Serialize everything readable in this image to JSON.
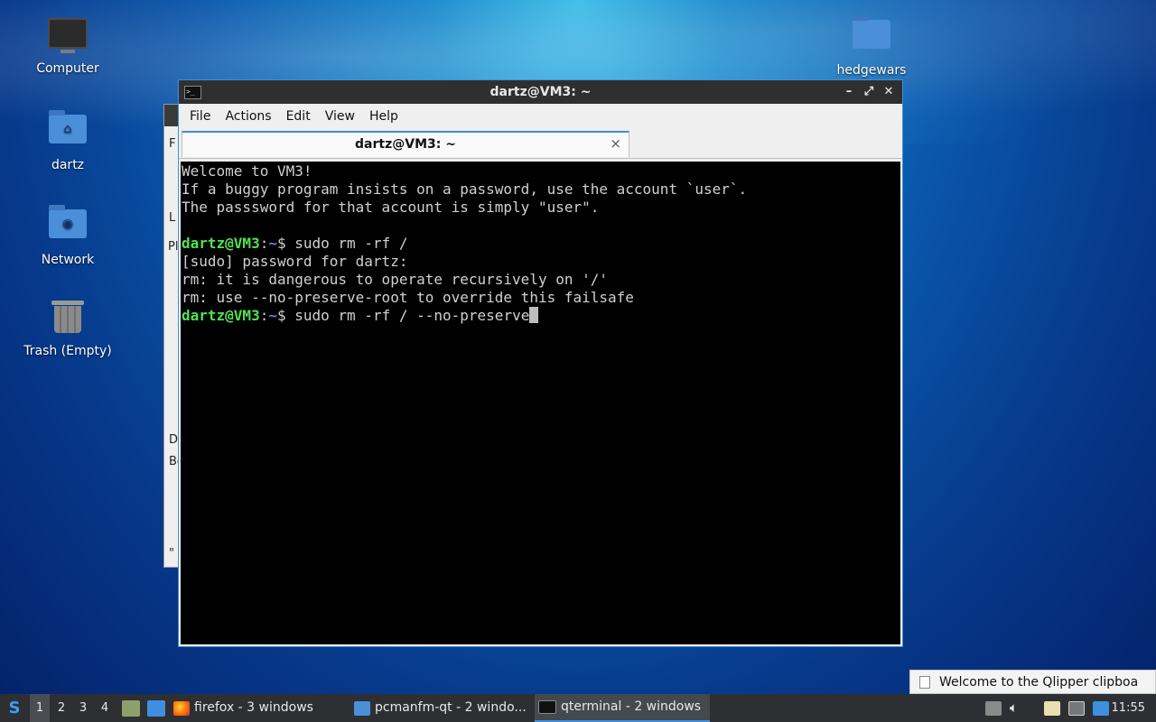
{
  "desktop": {
    "icons": [
      {
        "label": "Computer"
      },
      {
        "label": "dartz"
      },
      {
        "label": "Network"
      },
      {
        "label": "Trash (Empty)"
      },
      {
        "label": "hedgewars"
      }
    ]
  },
  "background_window": {
    "fragments": [
      "F",
      "L",
      "Pl",
      "D",
      "Bo",
      "\""
    ]
  },
  "terminal": {
    "title": "dartz@VM3: ~",
    "menu": [
      "File",
      "Actions",
      "Edit",
      "View",
      "Help"
    ],
    "tab_label": "dartz@VM3: ~",
    "tab_close": "×",
    "controls": {
      "minimize": "–",
      "maximize": "⤢",
      "close": "✕"
    },
    "lines": [
      "Welcome to VM3!",
      "If a buggy program insists on a password, use the account `user`.",
      "The passsword for that account is simply \"user\".",
      "",
      "[sudo] password for dartz:",
      "rm: it is dangerous to operate recursively on '/'",
      "rm: use --no-preserve-root to override this failsafe"
    ],
    "prompt": {
      "user_host": "dartz@VM3",
      "sep": ":",
      "path": "~",
      "symbol": "$ "
    },
    "commands": [
      "sudo rm -rf /",
      "sudo rm -rf / --no-preserve"
    ]
  },
  "notification": {
    "text": "Welcome to the Qlipper clipboa"
  },
  "taskbar": {
    "workspaces": [
      "1",
      "2",
      "3",
      "4"
    ],
    "tasks": [
      {
        "label": "firefox - 3 windows"
      },
      {
        "label": "pcmanfm-qt - 2 windo..."
      },
      {
        "label": "qterminal - 2 windows"
      }
    ],
    "clock": "11:55"
  },
  "colors": {
    "accent": "#3f8fde",
    "prompt_user": "#4fe34f",
    "prompt_path": "#4d8fe8",
    "terminal_bg": "#000000",
    "terminal_fg": "#d0d0d0",
    "taskbar_bg": "#2d2f33"
  }
}
